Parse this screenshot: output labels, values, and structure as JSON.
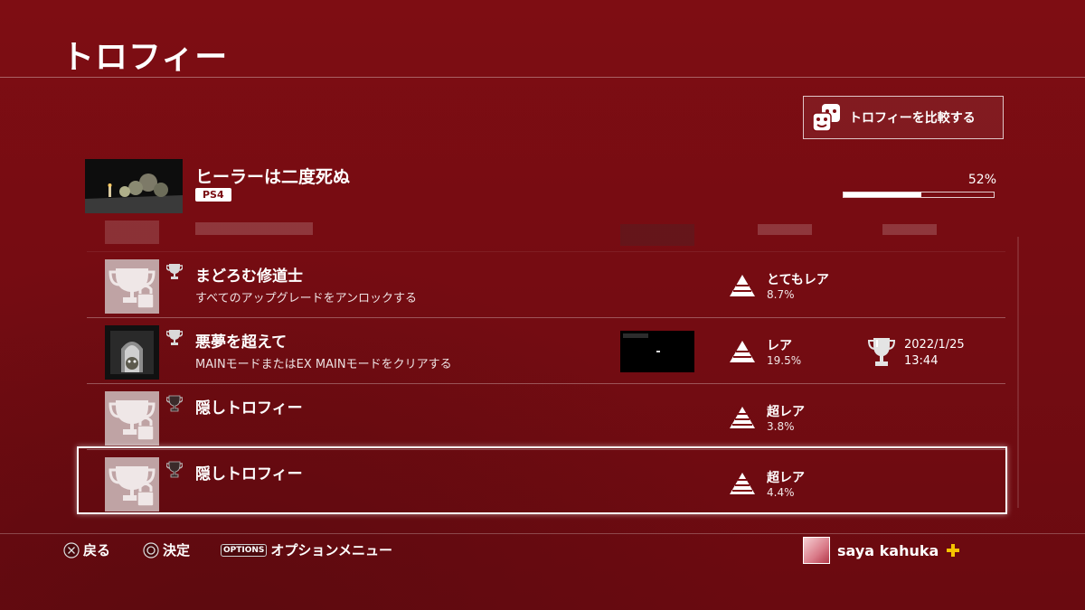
{
  "page": {
    "title": "トロフィー"
  },
  "compare": {
    "label": "トロフィーを比較する",
    "icon": "compare-faces-icon"
  },
  "game": {
    "title": "ヒーラーは二度死ぬ",
    "platform": "PS4",
    "progress_text": "52%",
    "progress": 0.52
  },
  "trophies": [
    {
      "name": "まどろむ修道士",
      "description": "すべてのアップグレードをアンロックする",
      "grade": "silver",
      "rarity_label": "とてもレア",
      "rarity_pct": "8.7%",
      "locked": true
    },
    {
      "name": "悪夢を超えて",
      "description": "MAINモードまたはEX MAINモードをクリアする",
      "grade": "silver",
      "rarity_label": "レア",
      "rarity_pct": "19.5%",
      "locked": false,
      "earned_date": "2022/1/25",
      "earned_time": "13:44"
    },
    {
      "name": "隠しトロフィー",
      "description": "",
      "grade": "hidden",
      "rarity_label": "超レア",
      "rarity_pct": "3.8%",
      "locked": true
    },
    {
      "name": "隠しトロフィー",
      "description": "",
      "grade": "hidden",
      "rarity_label": "超レア",
      "rarity_pct": "4.4%",
      "locked": true
    }
  ],
  "footer": {
    "back_label": "戻る",
    "confirm_label": "決定",
    "options_tag": "OPTIONS",
    "options_label": "オプションメニュー",
    "username": "saya kahuka"
  },
  "colors": {
    "background": "#7e0d13",
    "accent": "#ffffff",
    "plus": "#f5c400"
  }
}
